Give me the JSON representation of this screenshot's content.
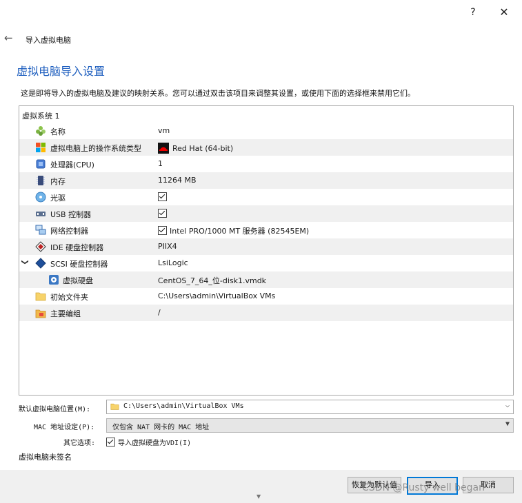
{
  "titlebar": {
    "help_label": "?",
    "close_label": "✕"
  },
  "nav": {
    "back_icon": "back-arrow-icon",
    "title": "导入虚拟电脑"
  },
  "heading": "虚拟电脑导入设置",
  "description": "这是即将导入的虚拟电脑及建议的映射关系。您可以通过双击该项目来调整其设置，或使用下面的选择框来禁用它们。",
  "appliance": {
    "group_label": "虚拟系统 1",
    "rows": [
      {
        "icon": "name-icon",
        "label": "名称",
        "value": "vm"
      },
      {
        "icon": "os-type-icon",
        "label": "虚拟电脑上的操作系统类型",
        "value": "Red Hat (64-bit)",
        "value_icon": "redhat-icon"
      },
      {
        "icon": "cpu-icon",
        "label": "处理器(CPU)",
        "value": "1"
      },
      {
        "icon": "memory-icon",
        "label": "内存",
        "value": "11264 MB"
      },
      {
        "icon": "optical-drive-icon",
        "label": "光驱",
        "checked": true
      },
      {
        "icon": "usb-icon",
        "label": "USB 控制器",
        "checked": true
      },
      {
        "icon": "network-icon",
        "label": "网络控制器",
        "checked": true,
        "value": "Intel PRO/1000 MT 服务器 (82545EM)"
      },
      {
        "icon": "ide-controller-icon",
        "label": "IDE 硬盘控制器",
        "value": "PIIX4"
      },
      {
        "icon": "scsi-controller-icon",
        "label": "SCSI 硬盘控制器",
        "value": "LsiLogic",
        "expanded": true
      },
      {
        "icon": "hard-disk-icon",
        "label": "虚拟硬盘",
        "value": "CentOS_7_64_位-disk1.vmdk",
        "indent": true
      },
      {
        "icon": "folder-icon",
        "label": "初始文件夹",
        "value": "C:\\Users\\admin\\VirtualBox VMs"
      },
      {
        "icon": "group-icon",
        "label": "主要编组",
        "value": "/"
      }
    ]
  },
  "settings": {
    "default_location_label": "默认虚拟电脑位置(M):",
    "default_location_value": "C:\\Users\\admin\\VirtualBox VMs",
    "mac_policy_label": "MAC 地址设定(P):",
    "mac_policy_value": "仅包含 NAT 网卡的 MAC 地址",
    "other_options_label": "其它选项:",
    "import_vdi_label": "导入虚拟硬盘为VDI(I)",
    "import_vdi_checked": true
  },
  "unsigned_text": "虚拟电脑未签名",
  "buttons": {
    "restore_defaults": "恢复为默认值",
    "import": "导入",
    "cancel": "取消"
  },
  "watermark": "CSDN @Rusty well began",
  "colors": {
    "heading": "#1f5fbf",
    "accent": "#0078d7",
    "alt_row": "#f0f0f0"
  }
}
